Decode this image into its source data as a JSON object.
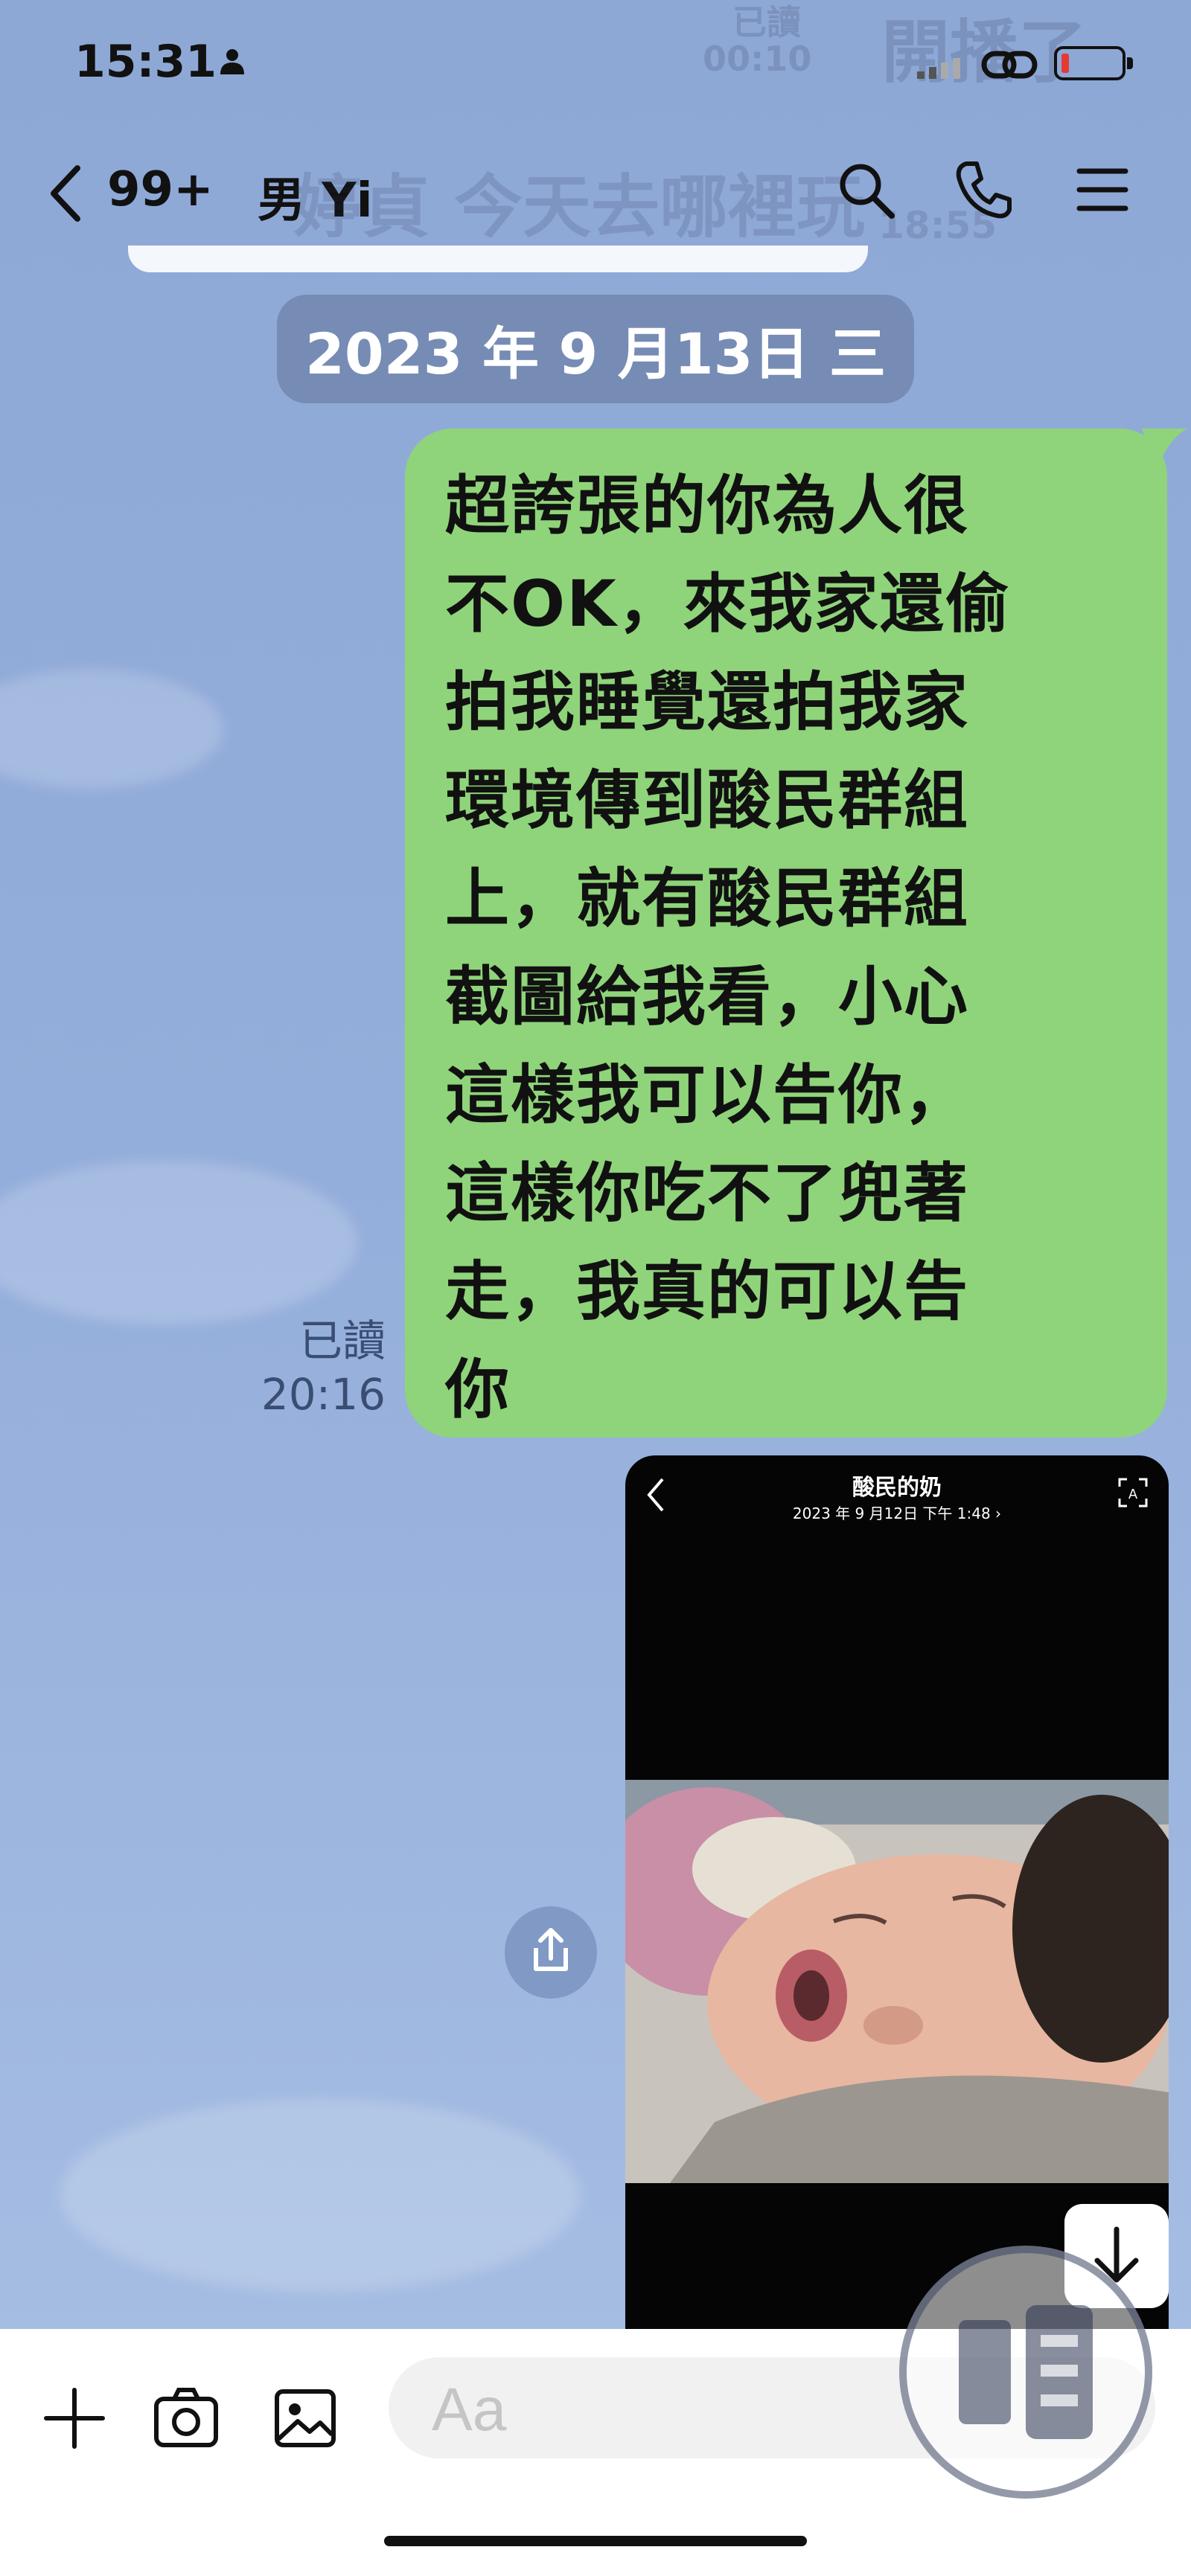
{
  "status_bar": {
    "time": "15:31",
    "ghost_read": "已讀",
    "ghost_time": "00:10",
    "ghost_banner": "開播了"
  },
  "header": {
    "unread_count": "99+",
    "chat_name": "男 Yi",
    "ghost_preview": "婷貞 今天去哪裡玩",
    "ghost_time": "18:55"
  },
  "date_chip": "2023 年 9 月13日 三",
  "message": {
    "text": "超誇張的你為人很\n不OK，來我家還偷\n拍我睡覺還拍我家\n環境傳到酸民群組\n上，就有酸民群組\n截圖給我看，小心\n這樣我可以告你，\n這樣你吃不了兜著\n走，我真的可以告\n你",
    "read_label": "已讀",
    "time": "20:16"
  },
  "image_message": {
    "title": "酸民的奶",
    "subtitle": "2023 年 9 月12日 下午 1:48 ›"
  },
  "input": {
    "placeholder": "Aa"
  },
  "colors": {
    "background": "#8fa9d6",
    "bubble": "#8fd47a",
    "date_chip": "#6e82aa"
  }
}
